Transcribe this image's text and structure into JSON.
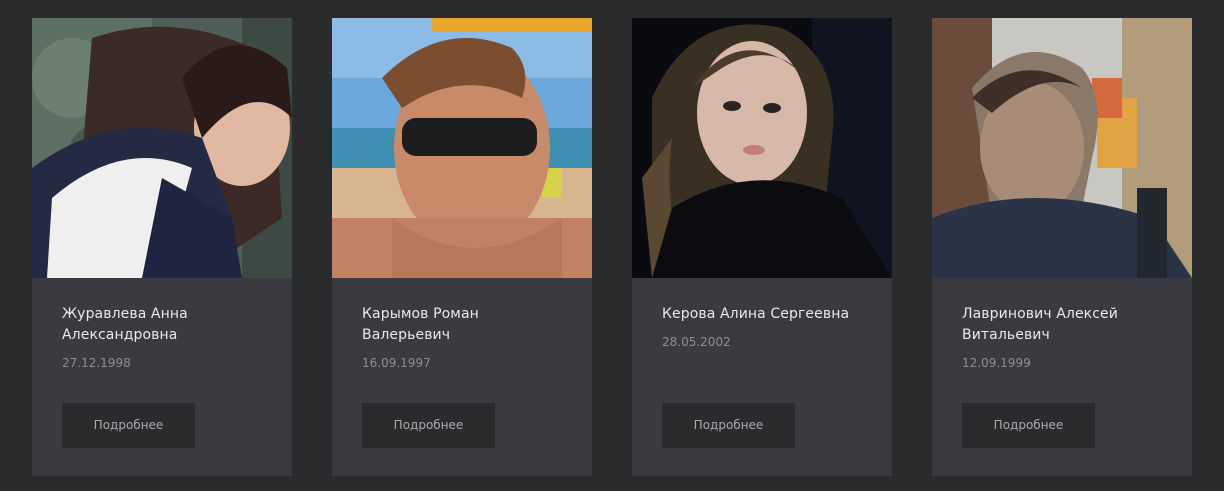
{
  "people": [
    {
      "name": "Журавлева Анна Александровна",
      "date": "27.12.1998",
      "more_label": "Подробнее"
    },
    {
      "name": "Карымов Роман Валерьевич",
      "date": "16.09.1997",
      "more_label": "Подробнее"
    },
    {
      "name": "Керова Алина Сергеевна",
      "date": "28.05.2002",
      "more_label": "Подробнее"
    },
    {
      "name": "Лавринович Алексей Витальевич",
      "date": "12.09.1999",
      "more_label": "Подробнее"
    }
  ],
  "colors": {
    "page_background": "#2a2b2d",
    "card_background": "#3a3b40",
    "button_background": "#2a2b2d",
    "name_text": "#e9e9ea",
    "date_text": "#8d8e92"
  }
}
